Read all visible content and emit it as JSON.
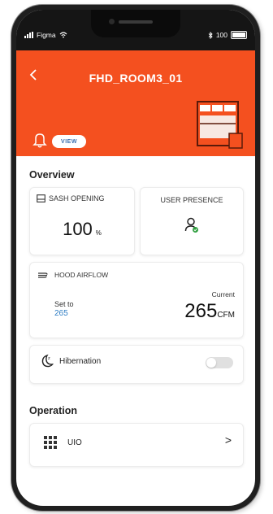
{
  "status_bar": {
    "carrier": "Figma",
    "wifi_icon": "wifi-icon",
    "bluetooth_icon": "bluetooth-icon",
    "battery_text": "100"
  },
  "header": {
    "title": "FHD_ROOM3_01",
    "back_icon": "chevron-left-icon",
    "view_label": "VIEW",
    "bell_icon": "bell-icon",
    "illustration": "fume-hood-illustration",
    "color": "#f4501f"
  },
  "overview": {
    "heading": "Overview",
    "sash": {
      "label": "SASH OPENING",
      "value": "100",
      "unit": "%",
      "icon": "window-icon"
    },
    "presence": {
      "label": "USER PRESENCE",
      "icon": "user-check-icon"
    },
    "airflow": {
      "label": "HOOD AIRFLOW",
      "icon": "wind-icon",
      "set_label": "Set to",
      "set_value": "265",
      "current_label": "Current",
      "current_value": "265",
      "current_unit": "CFM"
    },
    "hibernation": {
      "label": "Hibernation",
      "icon": "moon-sleep-icon",
      "enabled": false
    }
  },
  "operation": {
    "heading": "Operation",
    "item": {
      "label": "UIO",
      "icon": "grid-icon",
      "chevron": ">"
    }
  },
  "colors": {
    "accent": "#f4501f",
    "link_blue": "#2f7ec4",
    "dark": "#151515"
  }
}
